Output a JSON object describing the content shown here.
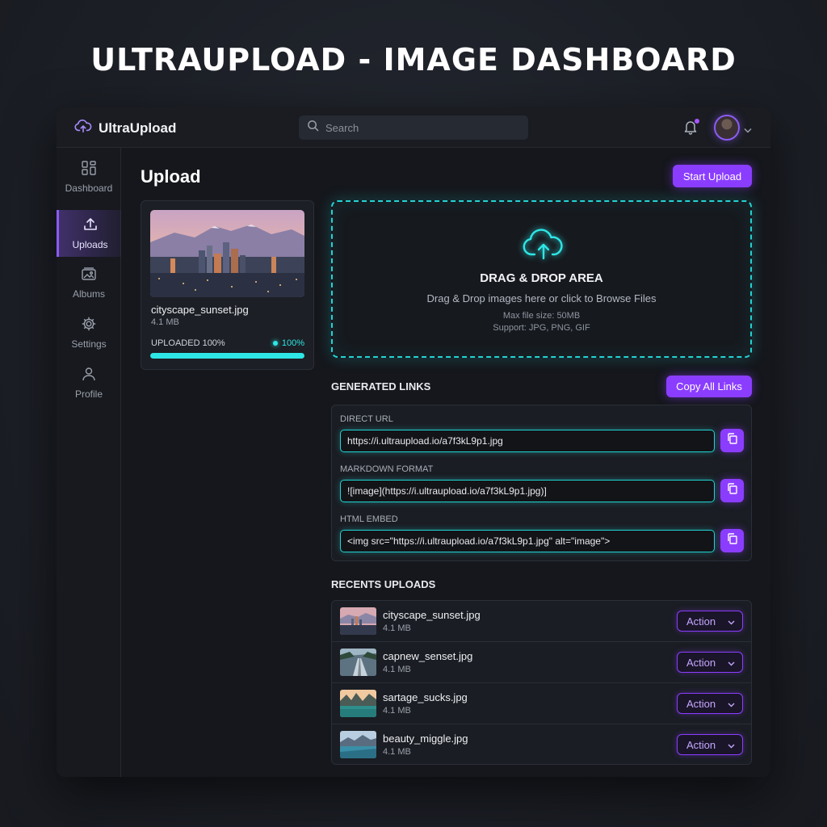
{
  "page_heading": "ULTRAUPLOAD - IMAGE DASHBOARD",
  "app": {
    "brand_name": "UltraUpload",
    "brand_icon": "cloud-upload-icon"
  },
  "topbar": {
    "search_placeholder": "Search",
    "notification_icon": "bell-icon",
    "notification_badge_color": "#a855f7"
  },
  "sidebar": {
    "items": [
      {
        "label": "Dashboard",
        "icon": "grid-icon",
        "active": false
      },
      {
        "label": "Uploads",
        "icon": "upload-icon",
        "active": true
      },
      {
        "label": "Albums",
        "icon": "image-stack-icon",
        "active": false
      },
      {
        "label": "Settings",
        "icon": "gear-icon",
        "active": false
      },
      {
        "label": "Profile",
        "icon": "user-icon",
        "active": false
      }
    ]
  },
  "main": {
    "title": "Upload",
    "start_upload_label": "Start Upload"
  },
  "current_file": {
    "name": "cityscape_sunset.jpg",
    "size": "4.1 MB",
    "status_label": "UPLOADED 100%",
    "percent_label": "100%",
    "progress": 1.0
  },
  "dropzone": {
    "title": "DRAG & DROP AREA",
    "subtitle": "Drag & Drop images here or click to Browse Files",
    "max_size": "Max file size: 50MB",
    "support": "Support: JPG, PNG, GIF"
  },
  "links": {
    "section_title": "GENERATED LINKS",
    "copy_all_label": "Copy All Links",
    "items": [
      {
        "label": "DIRECT URL",
        "value": "https://i.ultraupload.io/a7f3kL9p1.jpg"
      },
      {
        "label": "MARKDOWN FORMAT",
        "value": "![image](https://i.ultraupload.io/a7f3kL9p1.jpg)]"
      },
      {
        "label": "HTML EMBED",
        "value": "<img src=\"https://i.ultraupload.io/a7f3kL9p1.jpg\" alt=\"image\">"
      }
    ]
  },
  "recent": {
    "section_title": "RECENTS UPLOADS",
    "action_label": "Action",
    "items": [
      {
        "name": "cityscape_sunset.jpg",
        "size": "4.1 MB"
      },
      {
        "name": "capnew_senset.jpg",
        "size": "4.1 MB"
      },
      {
        "name": "sartage_sucks.jpg",
        "size": "4.1 MB"
      },
      {
        "name": "beauty_miggle.jpg",
        "size": "4.1 MB"
      }
    ]
  },
  "colors": {
    "accent_purple": "#8b3dff",
    "accent_cyan": "#22d3d3",
    "background": "#1c1f26"
  }
}
